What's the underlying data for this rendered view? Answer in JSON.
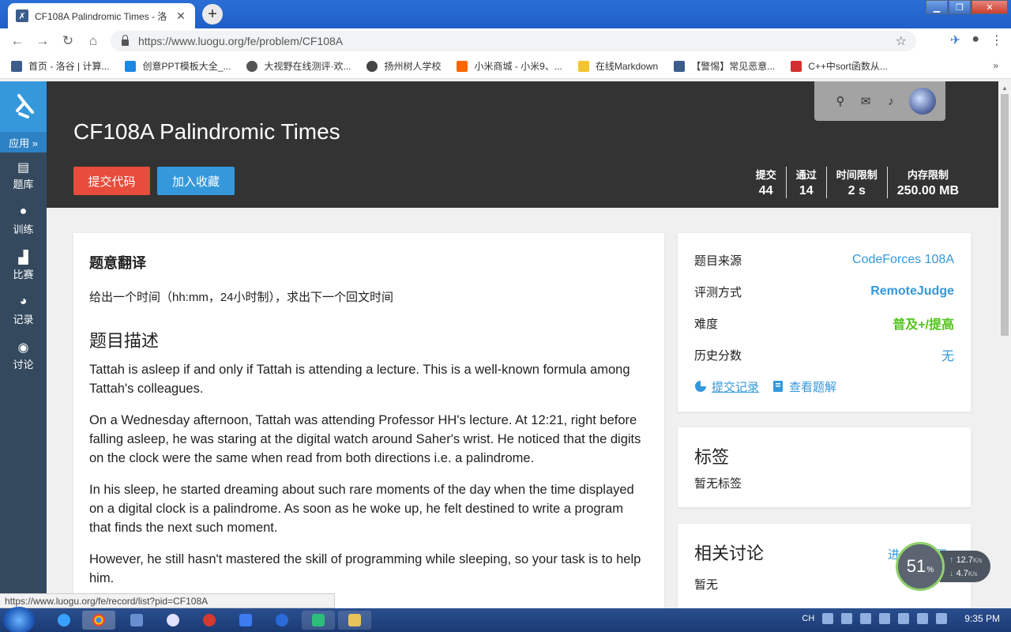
{
  "browser": {
    "tab_title": "CF108A Palindromic Times - 洛",
    "url": "https://www.luogu.org/fe/problem/CF108A",
    "bookmarks": [
      {
        "label": "首页 - 洛谷 | 计算...",
        "color": "#3b5d8c"
      },
      {
        "label": "创意PPT模板大全_...",
        "color": "#1e88e5"
      },
      {
        "label": "大视野在线测评·欢...",
        "color": "#555555"
      },
      {
        "label": "扬州树人学校",
        "color": "#444444"
      },
      {
        "label": "小米商城 - 小米9、...",
        "color": "#ff6700"
      },
      {
        "label": "在线Markdown",
        "color": "#f4c430"
      },
      {
        "label": "【警惕】常见恶意...",
        "color": "#3b5d8c"
      },
      {
        "label": "C++中sort函数从...",
        "color": "#d32f2f"
      }
    ],
    "status_url": "https://www.luogu.org/fe/record/list?pid=CF108A"
  },
  "sidebar": {
    "app_label": "应用 »",
    "items": [
      {
        "label": "题库",
        "icon": "book-icon"
      },
      {
        "label": "训练",
        "icon": "lightbulb-icon"
      },
      {
        "label": "比赛",
        "icon": "bar-chart-icon"
      },
      {
        "label": "记录",
        "icon": "pie-chart-icon"
      },
      {
        "label": "讨论",
        "icon": "comments-icon"
      }
    ]
  },
  "header": {
    "title": "CF108A Palindromic Times",
    "submit_label": "提交代码",
    "favorite_label": "加入收藏",
    "stats": [
      {
        "label": "提交",
        "value": "44"
      },
      {
        "label": "通过",
        "value": "14"
      },
      {
        "label": "时间限制",
        "value": "2 s"
      },
      {
        "label": "内存限制",
        "value": "250.00 MB"
      }
    ]
  },
  "content": {
    "translation_heading": "题意翻译",
    "translation_text": "给出一个时间（hh:mm，24小时制），求出下一个回文时间",
    "description_heading": "题目描述",
    "paragraphs": [
      "Tattah is asleep if and only if Tattah is attending a lecture. This is a well-known formula among Tattah's colleagues.",
      "On a Wednesday afternoon, Tattah was attending Professor HH's lecture. At 12:21, right before falling asleep, he was staring at the digital watch around Saher's wrist. He noticed that the digits on the clock were the same when read from both directions i.e. a palindrome.",
      "In his sleep, he started dreaming about such rare moments of the day when the time displayed on a digital clock is a palindrome. As soon as he woke up, he felt destined to write a program that finds the next such moment.",
      "However, he still hasn't mastered the skill of programming while sleeping, so your task is to help him."
    ]
  },
  "info": {
    "rows": [
      {
        "label": "题目来源",
        "value": "CodeForces 108A"
      },
      {
        "label": "评测方式",
        "value": "RemoteJudge"
      },
      {
        "label": "难度",
        "value": "普及+/提高"
      },
      {
        "label": "历史分数",
        "value": "无"
      }
    ],
    "records_link": " 提交记录 ",
    "solutions_link": "查看题解"
  },
  "tags": {
    "heading": "标签",
    "empty": "暂无标签"
  },
  "discussions": {
    "heading": "相关讨论",
    "empty": "暂无",
    "link": "进入讨论区"
  },
  "speed_widget": {
    "percent": "51",
    "percent_sign": "%",
    "up": "12.7",
    "down": "4.7",
    "unit": "K/s"
  },
  "taskbar": {
    "lang": "CH",
    "time": "9:35 PM"
  },
  "colors": {
    "accent": "#3498db",
    "danger": "#e74c3c",
    "difficulty": "#52c41a",
    "header_bg": "#333333",
    "sidebar_bg": "#34495e"
  }
}
